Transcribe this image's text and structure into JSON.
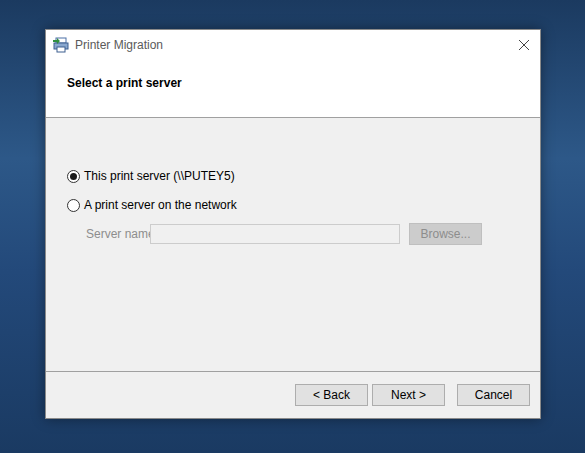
{
  "window": {
    "title": "Printer Migration"
  },
  "header": {
    "title": "Select a print server"
  },
  "options": [
    {
      "label": "This print server (\\\\PUTEY5)",
      "selected": true
    },
    {
      "label": "A print server on the network",
      "selected": false
    }
  ],
  "server_field": {
    "label": "Server name:",
    "value": "",
    "disabled": true
  },
  "browse_button": {
    "label": "Browse...",
    "disabled": true
  },
  "buttons": [
    {
      "label": "< Back"
    },
    {
      "label": "Next >"
    },
    {
      "label": "Cancel"
    }
  ]
}
